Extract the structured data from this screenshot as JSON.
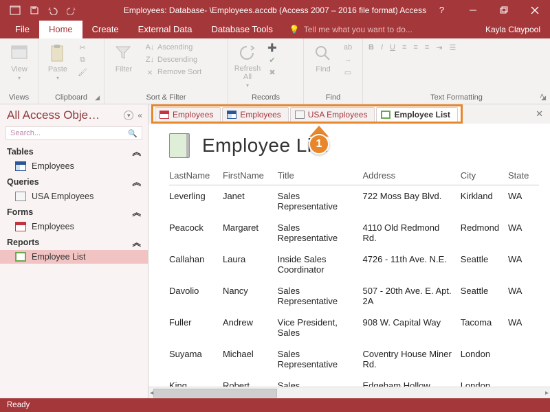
{
  "titlebar": {
    "title": "Employees: Database- \\Employees.accdb (Access 2007 – 2016 file format) Access"
  },
  "menu": {
    "file": "File",
    "home": "Home",
    "create": "Create",
    "external": "External Data",
    "tools": "Database Tools",
    "tell": "Tell me what you want to do...",
    "user": "Kayla Claypool"
  },
  "ribbon": {
    "views": {
      "label": "Views",
      "view": "View"
    },
    "clipboard": {
      "label": "Clipboard",
      "paste": "Paste"
    },
    "sortfilter": {
      "label": "Sort & Filter",
      "filter": "Filter",
      "asc": "Ascending",
      "desc": "Descending",
      "remove": "Remove Sort"
    },
    "records": {
      "label": "Records",
      "refresh": "Refresh All"
    },
    "find": {
      "label": "Find",
      "find": "Find"
    },
    "textfmt": {
      "label": "Text Formatting"
    }
  },
  "nav": {
    "header": "All Access Obje…",
    "search_ph": "Search...",
    "groups": {
      "tables": "Tables",
      "queries": "Queries",
      "forms": "Forms",
      "reports": "Reports"
    },
    "items": {
      "t_employees": "Employees",
      "q_usa": "USA Employees",
      "f_employees": "Employees",
      "r_list": "Employee List"
    }
  },
  "doctabs": {
    "t0": "Employees",
    "t1": "Employees",
    "t2": "USA Employees",
    "t3": "Employee List"
  },
  "report": {
    "title": "Employee List",
    "callout": "1",
    "cols": {
      "ln": "LastName",
      "fn": "FirstName",
      "ti": "Title",
      "ad": "Address",
      "ci": "City",
      "st": "State"
    },
    "rows": [
      {
        "ln": "Leverling",
        "fn": "Janet",
        "ti": "Sales Representative",
        "ad": "722 Moss Bay Blvd.",
        "ci": "Kirkland",
        "st": "WA"
      },
      {
        "ln": "Peacock",
        "fn": "Margaret",
        "ti": "Sales Representative",
        "ad": "4110 Old Redmond Rd.",
        "ci": "Redmond",
        "st": "WA"
      },
      {
        "ln": "Callahan",
        "fn": "Laura",
        "ti": "Inside Sales Coordinator",
        "ad": "4726 - 11th Ave. N.E.",
        "ci": "Seattle",
        "st": "WA"
      },
      {
        "ln": "Davolio",
        "fn": "Nancy",
        "ti": "Sales Representative",
        "ad": "507 - 20th Ave. E. Apt. 2A",
        "ci": "Seattle",
        "st": "WA"
      },
      {
        "ln": "Fuller",
        "fn": "Andrew",
        "ti": "Vice President, Sales",
        "ad": "908 W. Capital Way",
        "ci": "Tacoma",
        "st": "WA"
      },
      {
        "ln": "Suyama",
        "fn": "Michael",
        "ti": "Sales Representative",
        "ad": "Coventry House Miner Rd.",
        "ci": "London",
        "st": ""
      },
      {
        "ln": "King",
        "fn": "Robert",
        "ti": "Sales",
        "ad": "Edgeham Hollow",
        "ci": "London",
        "st": ""
      }
    ]
  },
  "status": {
    "text": "Ready"
  }
}
